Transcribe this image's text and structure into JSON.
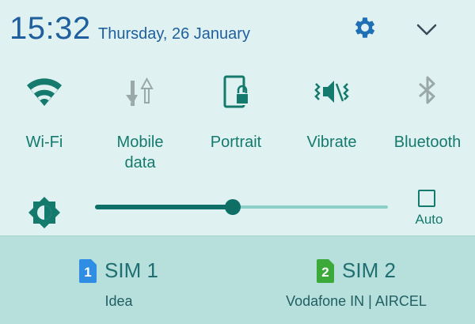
{
  "status": {
    "time": "15:32",
    "date": "Thursday, 26 January",
    "settings_icon": "gear-icon",
    "expand_icon": "chevron-down-icon"
  },
  "tiles": [
    {
      "label": "Wi-Fi",
      "icon": "wifi-icon",
      "active": true
    },
    {
      "label": "Mobile\ndata",
      "icon": "mobile-data-icon",
      "active": false
    },
    {
      "label": "Portrait",
      "icon": "portrait-lock-icon",
      "active": true
    },
    {
      "label": "Vibrate",
      "icon": "vibrate-icon",
      "active": true
    },
    {
      "label": "Bluetooth",
      "icon": "bluetooth-icon",
      "active": false
    }
  ],
  "brightness": {
    "level": 0.47,
    "auto_label": "Auto",
    "auto_checked": false
  },
  "sims": [
    {
      "badge": "1",
      "name": "SIM 1",
      "operator": "Idea",
      "color": "#2f8de4"
    },
    {
      "badge": "2",
      "name": "SIM 2",
      "operator": "Vodafone IN | AIRCEL",
      "color": "#3caa3a"
    }
  ],
  "colors": {
    "accent": "#157a6e",
    "accent_dark": "#0e6f66",
    "inactive": "#9aa8a8",
    "background": "#dff1f0",
    "sim_panel": "#b7dfdc"
  }
}
